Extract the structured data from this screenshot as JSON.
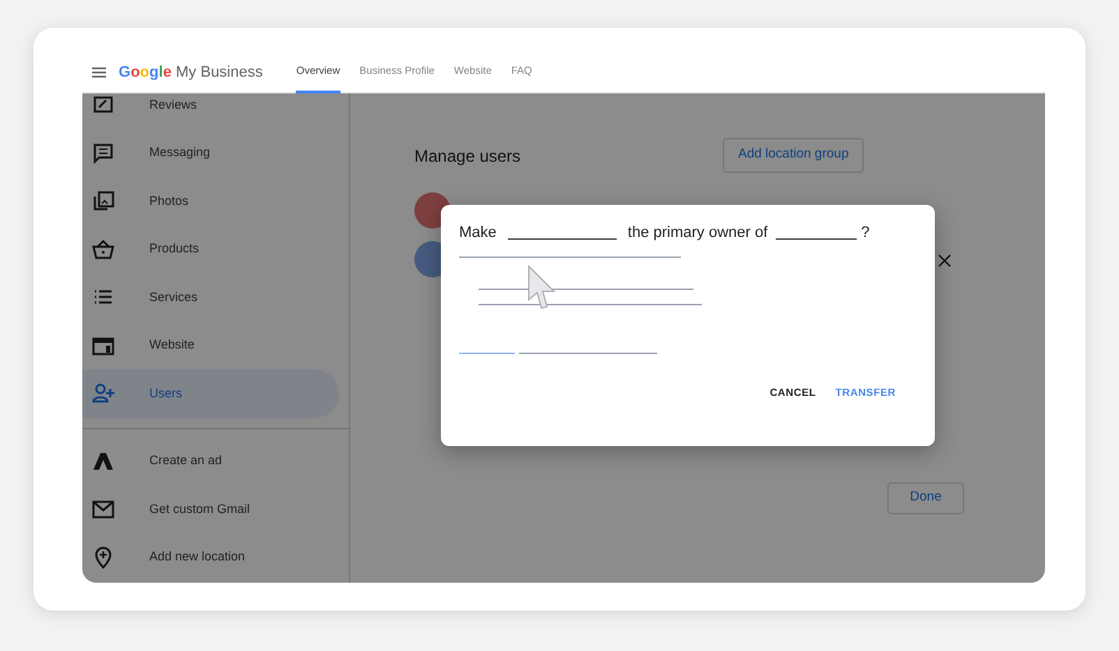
{
  "header": {
    "logo": "Google",
    "app_name": "My Business",
    "tabs": [
      {
        "label": "Overview",
        "selected": true
      },
      {
        "label": "Business Profile",
        "selected": false
      },
      {
        "label": "Website",
        "selected": false
      },
      {
        "label": "FAQ",
        "selected": false
      }
    ]
  },
  "sidebar": {
    "items": [
      {
        "label": "Reviews",
        "selected": false
      },
      {
        "label": "Messaging",
        "selected": false
      },
      {
        "label": "Photos",
        "selected": false
      },
      {
        "label": "Products",
        "selected": false
      },
      {
        "label": "Services",
        "selected": false
      },
      {
        "label": "Website",
        "selected": false
      },
      {
        "label": "Users",
        "selected": true
      }
    ],
    "extra_items": [
      {
        "label": "Create an ad"
      },
      {
        "label": "Get custom Gmail"
      },
      {
        "label": "Add new location"
      }
    ]
  },
  "content": {
    "title": "Manage users",
    "add_button": "Add location group",
    "done_button": "Done"
  },
  "dialog": {
    "text_before": "Make",
    "text_middle": "the primary owner of",
    "text_end": "?",
    "buttons": [
      {
        "label": "CANCEL",
        "kind": "secondary"
      },
      {
        "label": "TRANSFER",
        "kind": "primary"
      }
    ]
  }
}
